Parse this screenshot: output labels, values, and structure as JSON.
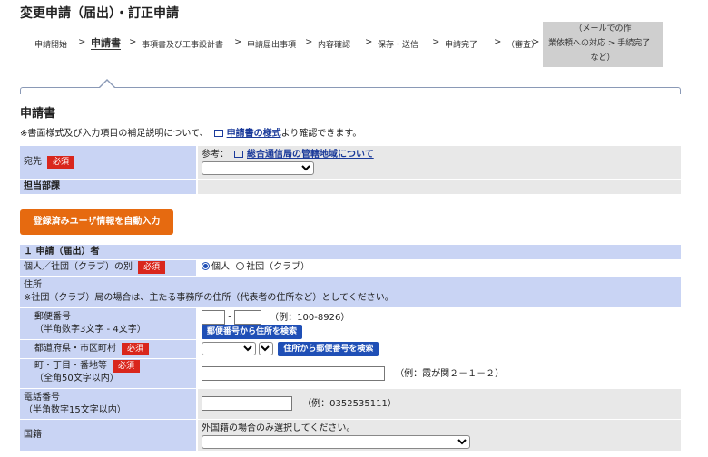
{
  "page": {
    "title": "変更申請（届出）・訂正申請"
  },
  "steps": {
    "items": [
      "申請開始",
      "申請書",
      "事項書及び工事設計書",
      "申請届出事項",
      "内容確認",
      "保存・送信",
      "申請完了",
      "（審査）"
    ],
    "gray": {
      "line1": "（メールでの作",
      "line2": "業依頼への対応",
      "line3": "など）"
    },
    "last": "手続完了",
    "separator": ">"
  },
  "section": {
    "title": "申請書",
    "note_prefix": "※書面様式及び入力項目の補足説明について、",
    "note_link": "申請書の様式",
    "note_suffix": "より確認できます。"
  },
  "dest": {
    "label": "宛先",
    "required": "必須",
    "ref_prefix": "参考：",
    "ref_link": "総合通信局の管轄地域について",
    "select_value": ""
  },
  "dept": {
    "label": "担当部課"
  },
  "autofill_button": "登録済みユーザ情報を自動入力",
  "applicant": {
    "header": "１ 申請（届出）者",
    "type_label": "個人／社団（クラブ）の別",
    "required": "必須",
    "options": [
      "個人",
      "社団（クラブ）"
    ],
    "address_label": "住所",
    "address_note": "※社団（クラブ）局の場合は、主たる事務所の住所（代表者の住所など）としてください。",
    "postal": {
      "label": "郵便番号",
      "sublabel": "（半角数字3文字 - 4文字）",
      "dash": "-",
      "example": "（例：100-8926）",
      "button": "郵便番号から住所を検索"
    },
    "pref": {
      "label": "都道府県・市区町村",
      "required": "必須",
      "button": "住所から郵便番号を検索"
    },
    "town": {
      "label": "町・丁目・番地等",
      "sublabel": "（全角50文字以内）",
      "required": "必須",
      "example": "（例：霞が関２－１－２）"
    },
    "phone": {
      "label": "電話番号",
      "sublabel": "（半角数字15文字以内）",
      "example": "（例：0352535111）"
    },
    "nationality": {
      "label": "国籍",
      "note": "外国籍の場合のみ選択してください。"
    }
  }
}
